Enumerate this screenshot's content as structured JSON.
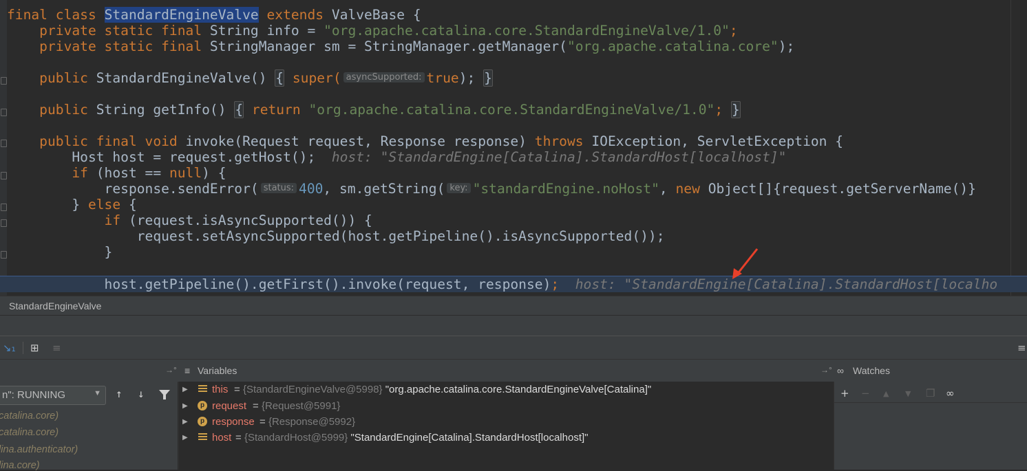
{
  "editor": {
    "lines": [
      {
        "id": "l1"
      },
      {
        "id": "l2"
      }
    ],
    "class_decl": {
      "kw1": "final class ",
      "name": "StandardEngineValve",
      "kw2": " extends ",
      "base": "ValveBase {"
    },
    "info_line": {
      "kw": "    private static final ",
      "type": "String info = ",
      "str": "\"org.apache.catalina.core.StandardEngineValve/1.0\"",
      "end": ";"
    },
    "sm_line": {
      "kw": "    private static final ",
      "text": "StringManager sm = StringManager.getManager(",
      "str": "\"org.apache.catalina.core\"",
      "end": ");"
    },
    "ctor_line": {
      "kw": "    public ",
      "text": "StandardEngineValve() ",
      "brace1": "{",
      "kw2": " super(",
      "hint": "asyncSupported:",
      "kw3": "true",
      "end": "); ",
      "brace2": "}"
    },
    "getinfo_line": {
      "kw": "    public ",
      "text": "String getInfo() ",
      "brace1": "{",
      "kw2": " return ",
      "str": "\"org.apache.catalina.core.StandardEngineValve/1.0\"",
      "end": "; ",
      "brace2": "}"
    },
    "invoke_line": {
      "kw": "    public final void ",
      "text": "invoke(Request request, Response response) ",
      "kw2": "throws ",
      "text2": "IOException, ServletException {"
    },
    "host_line": {
      "text": "        Host host = request.getHost();",
      "inline": "  host: \"StandardEngine[Catalina].StandardHost[localhost]\""
    },
    "if_line": {
      "kw": "        if ",
      "text": "(host == ",
      "kw2": "null",
      "end": ") {"
    },
    "senderror_line": {
      "text": "            response.sendError(",
      "hint1": "status:",
      "num": "400",
      "text2": ", sm.getString(",
      "hint2": "key:",
      "str": "\"standardEngine.noHost\"",
      "text3": ", ",
      "kw": "new ",
      "text4": "Object[]{request.getServerName()}"
    },
    "else_line": {
      "text": "        } ",
      "kw": "else",
      "end": " {"
    },
    "ifasync_line": {
      "kw": "            if ",
      "text": "(request.isAsyncSupported()) {"
    },
    "setasync_line": {
      "text": "                request.setAsyncSupported(host.getPipeline().isAsyncSupported());"
    },
    "close_line": {
      "text": "            }"
    },
    "current_line": {
      "text": "            host.getPipeline().getFirst().invoke(request, response)",
      "semi": ";",
      "inline": "  host: \"StandardEngine[Catalina].StandardHost[localho"
    }
  },
  "breadcrumb": {
    "label": "StandardEngineValve"
  },
  "debugger": {
    "frames_header_icon": "pin-icon",
    "variables_header": "Variables",
    "watches_header": "Watches",
    "thread_select": "n\": RUNNING",
    "frames": [
      "catalina.core)",
      "catalina.core)",
      "lina.authenticator)",
      "lina.core)"
    ],
    "variables": [
      {
        "icon": "field",
        "name": "this",
        "eq": " = ",
        "ref": "{StandardEngineValve@5998}",
        "val": " \"org.apache.catalina.core.StandardEngineValve[Catalina]\""
      },
      {
        "icon": "param",
        "name": "request",
        "eq": " = ",
        "ref": "{Request@5991}",
        "val": ""
      },
      {
        "icon": "param",
        "name": "response",
        "eq": " = ",
        "ref": "{Response@5992}",
        "val": ""
      },
      {
        "icon": "field",
        "name": "host",
        "eq": " = ",
        "ref": "{StandardHost@5999}",
        "val": " \"StandardEngine[Catalina].StandardHost[localhost]\""
      }
    ],
    "param_badge": "p"
  },
  "colors": {
    "keyword": "#cc7832",
    "string": "#6a8759",
    "number": "#6897bb",
    "text": "#a9b7c6",
    "background": "#2b2b2b",
    "annotation_arrow": "#e8402a"
  }
}
